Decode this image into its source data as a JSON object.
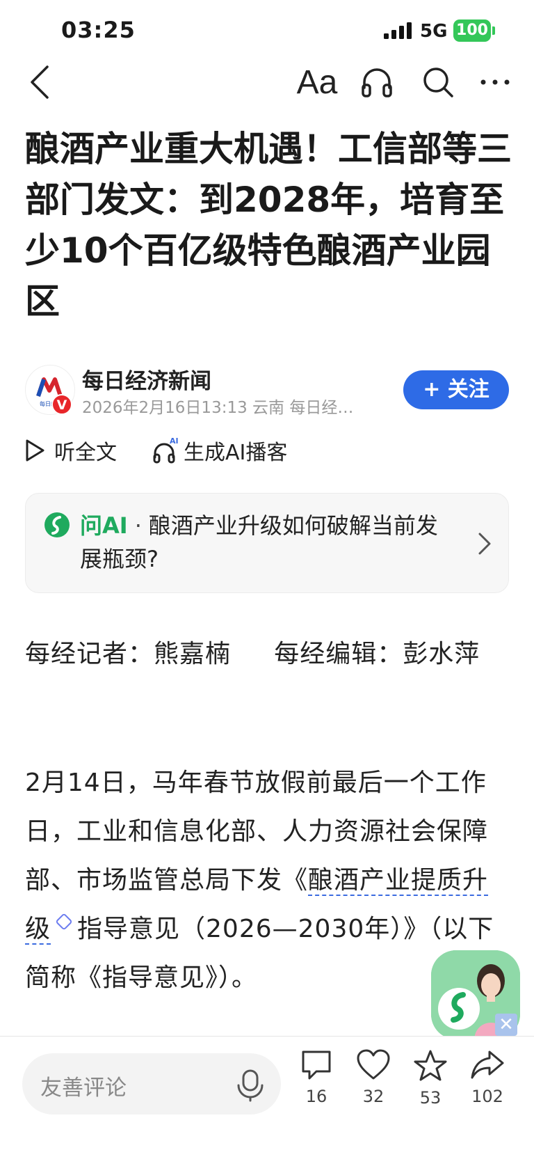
{
  "status_bar": {
    "time": "03:25",
    "network": "5G",
    "battery": "100"
  },
  "nav": {
    "font_label": "Aa",
    "icons": [
      "back-icon",
      "font-size-icon",
      "headphones-icon",
      "search-icon",
      "more-icon"
    ]
  },
  "article": {
    "title": "酿酒产业重大机遇！工信部等三部门发文：到2028年，培育至少10个百亿级特色酿酒产业园区"
  },
  "author": {
    "name": "每日经济新闻",
    "meta": "2026年2月16日13:13 云南 每日经…",
    "avatar_text": "每日经济",
    "verified_badge": "V",
    "follow_label": "+ 关注"
  },
  "actions": {
    "listen_label": "听全文",
    "podcast_label": "生成AI播客",
    "podcast_badge": "AI"
  },
  "ai_card": {
    "label": "问AI",
    "dot": "·",
    "question": "酿酒产业升级如何破解当前发展瓶颈?"
  },
  "body": {
    "byline": "每经记者：熊嘉楠     每经编辑：彭水萍",
    "para_part1": "2月14日，马年春节放假前最后一个工作日，工业和信息化部、人力资源社会保障部、市场监管总局下发《",
    "para_link": "酿酒产业提质升级",
    "para_part2": "指导意见（2026—2030年）》（以下简称《指导意见》）。"
  },
  "floating": {
    "close": "✕"
  },
  "bottom_bar": {
    "comment_placeholder": "友善评论",
    "comments": "16",
    "likes": "32",
    "favorites": "53",
    "shares": "102"
  },
  "colors": {
    "accent_blue": "#2e6be6",
    "ai_green": "#1faa5e",
    "battery_green": "#34c759",
    "verified_red": "#e8262a"
  }
}
